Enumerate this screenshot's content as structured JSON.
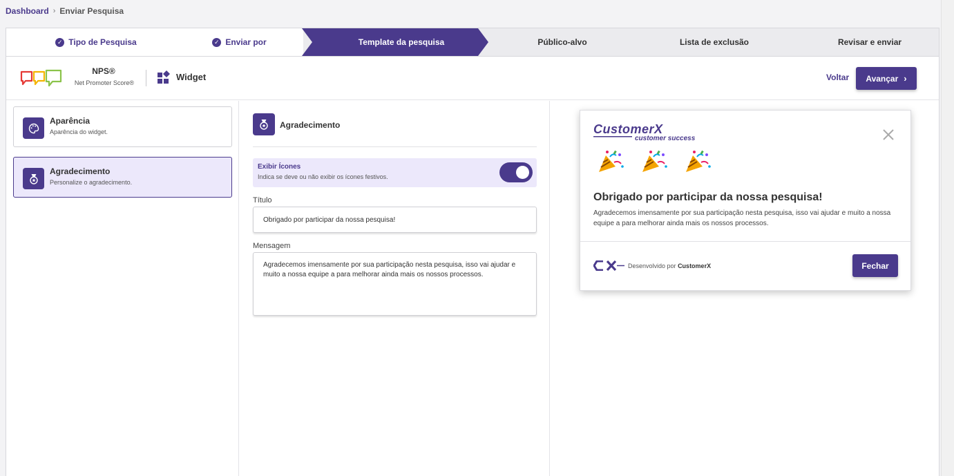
{
  "breadcrumb": {
    "dashboard": "Dashboard",
    "separator": "›",
    "current": "Enviar Pesquisa"
  },
  "stepper": {
    "steps": [
      {
        "label": "Tipo de Pesquisa",
        "state": "done"
      },
      {
        "label": "Enviar por",
        "state": "done"
      },
      {
        "label": "Template da pesquisa",
        "state": "active"
      },
      {
        "label": "Público-alvo",
        "state": "pending"
      },
      {
        "label": "Lista de exclusão",
        "state": "pending"
      },
      {
        "label": "Revisar e enviar",
        "state": "pending"
      }
    ]
  },
  "header": {
    "nps_title": "NPS®",
    "nps_subtitle": "Net Promoter Score®",
    "widget_label": "Widget",
    "back_label": "Voltar",
    "next_label": "Avançar",
    "next_icon": "chevron-right-icon"
  },
  "sidebar": {
    "items": [
      {
        "title": "Aparência",
        "desc": "Aparência do widget.",
        "icon": "palette-icon",
        "selected": false
      },
      {
        "title": "Agradecimento",
        "desc": "Personalize o agradecimento.",
        "icon": "medal-icon",
        "selected": true
      }
    ]
  },
  "editor": {
    "section_title": "Agradecimento",
    "toggle": {
      "title": "Exibir Ícones",
      "desc": "Indica se deve ou não exibir os ícones festivos.",
      "on": true
    },
    "title_label": "Título",
    "title_value": "Obrigado por participar da nossa pesquisa!",
    "message_label": "Mensagem",
    "message_value": "Agradecemos imensamente por sua participação nesta pesquisa, isso vai ajudar e muito a nossa equipe a para melhorar ainda mais os nossos processos."
  },
  "preview": {
    "brand_name": "CustomerX",
    "brand_tagline": "customer success",
    "icon_count": 3,
    "title": "Obrigado por participar da nossa pesquisa!",
    "message": "Agradecemos imensamente por sua participação nesta pesquisa, isso vai ajudar e muito a nossa equipe a para melhorar ainda mais os nossos processos.",
    "powered_prefix": "Desenvolvido por",
    "powered_brand": "CustomerX",
    "close_label": "Fechar"
  },
  "colors": {
    "primary": "#4a3a8c",
    "selected_bg": "#ece8fb",
    "step_pending_bg": "#ebebee"
  }
}
